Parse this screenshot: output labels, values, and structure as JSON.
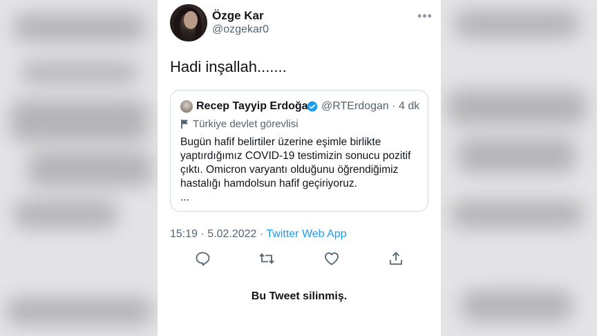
{
  "tweet": {
    "author_name": "Özge Kar",
    "author_handle": "@ozgekar0",
    "more_icon": "more-icon",
    "text": "Hadi inşallah.......",
    "timestamp": "15:19 · 5.02.2022 · ",
    "source": "Twitter Web App",
    "deleted_notice": "Bu Tweet silinmiş."
  },
  "quoted": {
    "author_name": "Recep Tayyip Erdoğan",
    "verified_icon": "verified-badge-icon",
    "handle_time": "@RTErdogan · 4 dk",
    "label_icon": "flag-icon",
    "label": "Türkiye devlet görevlisi",
    "lines": [
      "Bugün hafif belirtiler üzerine eşimle birlikte",
      "yaptırdığımız COVID-19 testimizin sonucu pozitif",
      "çıktı. Omicron varyantı olduğunu öğrendiğimiz",
      "hastalığı hamdolsun hafif geçiriyoruz.",
      "..."
    ]
  },
  "actions": [
    "reply-icon",
    "retweet-icon",
    "like-icon",
    "share-icon"
  ],
  "colors": {
    "accent": "#1d9bf0",
    "text": "#0f1419",
    "secondary": "#536471",
    "border": "#cfd9de"
  }
}
